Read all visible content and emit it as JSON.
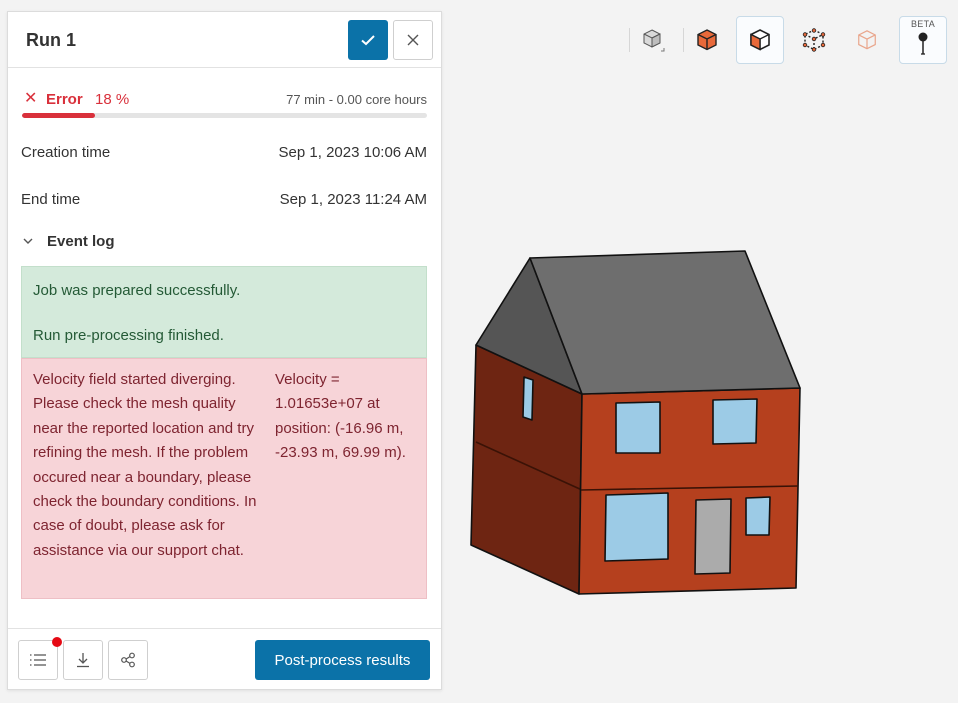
{
  "panel": {
    "title": "Run 1",
    "confirm_icon": "check-icon",
    "close_icon": "close-icon"
  },
  "status": {
    "label": "Error",
    "percent_text": "18 %",
    "progress": 0.18,
    "duration": "77 min - 0.00 core hours",
    "color": "#d9303b"
  },
  "info": {
    "creation_label": "Creation time",
    "creation_value": "Sep 1, 2023 10:06 AM",
    "end_label": "End time",
    "end_value": "Sep 1, 2023 11:24 AM"
  },
  "event_log": {
    "label": "Event log",
    "success_messages": [
      "Job was prepared successfully.",
      "Run pre-processing finished."
    ],
    "error_message": "Velocity field started diverging. Please check the mesh quality near the reported location and try refining the mesh. If the problem occured near a boundary, please check the boundary conditions. In case of doubt, please ask for assistance via our support chat.",
    "error_detail": "Velocity = 1.01653e+07 at position: (-16.96 m, -23.93 m, 69.99 m)."
  },
  "footer": {
    "post_process_label": "Post-process results",
    "icons": [
      "list-icon",
      "download-icon",
      "share-icon"
    ]
  },
  "toolbar": {
    "beta_label": "BETA",
    "icons": [
      "view-cube-icon",
      "solid-select-icon",
      "face-select-icon",
      "edge-select-icon",
      "vertex-select-icon",
      "probe-point-icon"
    ]
  },
  "colors": {
    "accent": "#0b72a8",
    "error": "#d9303b",
    "success_bg": "#d4eadb",
    "error_bg": "#f7d4d8",
    "brick": "#b5401e",
    "roof": "#6e6e6e",
    "window": "#9ccbe6"
  }
}
